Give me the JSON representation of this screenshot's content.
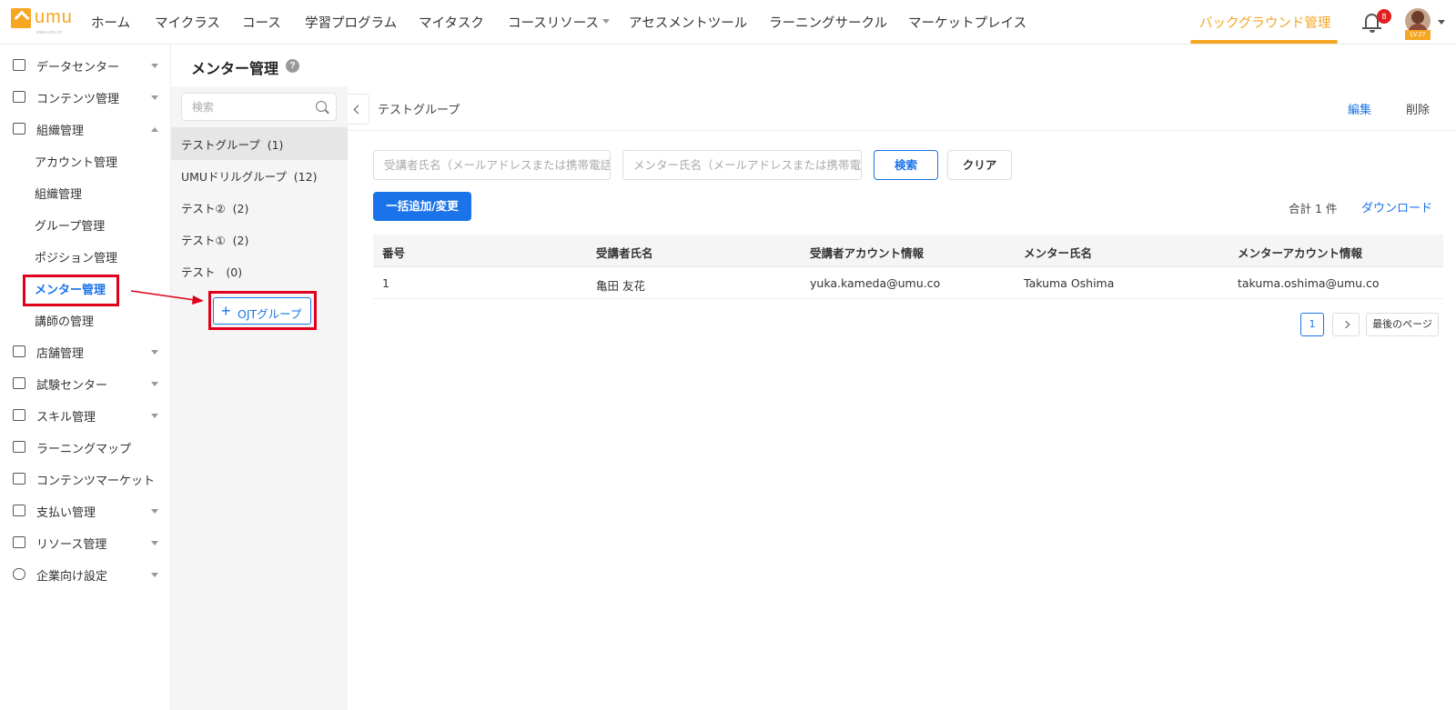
{
  "header": {
    "logo_text": "umu",
    "logo_sub": "www.umu.cn",
    "nav": [
      {
        "label": "ホーム"
      },
      {
        "label": "マイクラス"
      },
      {
        "label": "コース"
      },
      {
        "label": "学習プログラム"
      },
      {
        "label": "マイタスク"
      },
      {
        "label": "コースリソース"
      },
      {
        "label": "アセスメントツール"
      },
      {
        "label": "ラーニングサークル"
      },
      {
        "label": "マーケットプレイス"
      }
    ],
    "active_nav": "バックグラウンド管理",
    "notification_count": "8",
    "user_level": "LV.27",
    "accent_color": "#f5a623"
  },
  "sidebar": {
    "items": [
      {
        "label": "データセンター",
        "icon": "bar-chart-icon"
      },
      {
        "label": "コンテンツ管理",
        "icon": "content-icon"
      },
      {
        "label": "組織管理",
        "icon": "id-card-icon"
      },
      {
        "label": "アカウント管理"
      },
      {
        "label": "組織管理"
      },
      {
        "label": "グループ管理"
      },
      {
        "label": "ポジション管理"
      },
      {
        "label": "メンター管理"
      },
      {
        "label": "講師の管理"
      },
      {
        "label": "店舗管理",
        "icon": "store-icon"
      },
      {
        "label": "試験センター",
        "icon": "exam-icon"
      },
      {
        "label": "スキル管理",
        "icon": "clipboard-icon"
      },
      {
        "label": "ラーニングマップ",
        "icon": "map-icon"
      },
      {
        "label": "コンテンツマーケット",
        "icon": "market-icon"
      },
      {
        "label": "支払い管理",
        "icon": "wallet-icon"
      },
      {
        "label": "リソース管理",
        "icon": "resource-icon"
      },
      {
        "label": "企業向け設定",
        "icon": "settings-icon"
      }
    ]
  },
  "page": {
    "title": "メンター管理",
    "help": "?"
  },
  "groups": {
    "search_placeholder": "検索",
    "items": [
      {
        "label": "テストグループ  (1)"
      },
      {
        "label": "UMUドリルグループ  (12)"
      },
      {
        "label": "テスト②  (2)"
      },
      {
        "label": "テスト①  (2)"
      },
      {
        "label": "テスト   (0)"
      }
    ],
    "add_button": "OJTグループ"
  },
  "main": {
    "group_name": "テストグループ",
    "edit": "編集",
    "delete": "削除",
    "learner_placeholder": "受講者氏名（メールアドレスまたは携帯電話",
    "mentor_placeholder": "メンター氏名（メールアドレスまたは携帯電",
    "search_button": "検索",
    "clear_button": "クリア",
    "bulk_button": "一括追加/変更",
    "total": "合計 1 件",
    "download": "ダウンロード",
    "table": {
      "columns": [
        "番号",
        "受講者氏名",
        "受講者アカウント情報",
        "メンター氏名",
        "メンターアカウント情報"
      ],
      "rows": [
        [
          "1",
          "亀田 友花",
          "yuka.kameda@umu.co",
          "Takuma Oshima",
          "takuma.oshima@umu.co"
        ]
      ]
    },
    "pagination": {
      "current": "1",
      "last": "最後のページ"
    }
  }
}
